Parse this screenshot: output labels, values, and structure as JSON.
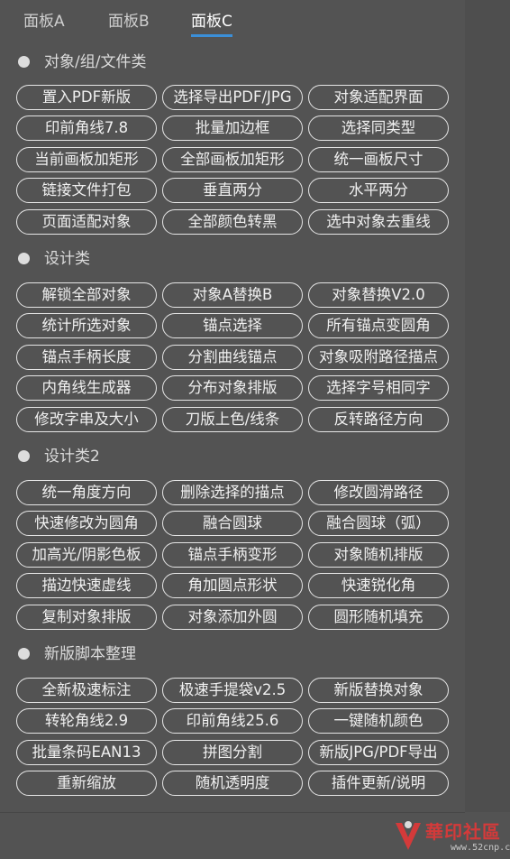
{
  "tabs": [
    {
      "label": "面板A",
      "active": false
    },
    {
      "label": "面板B",
      "active": false
    },
    {
      "label": "面板C",
      "active": true
    }
  ],
  "sections": [
    {
      "title": "对象/组/文件类",
      "buttons": [
        "置入PDF新版",
        "选择导出PDF/JPG",
        "对象适配界面",
        "印前角线7.8",
        "批量加边框",
        "选择同类型",
        "当前画板加矩形",
        "全部画板加矩形",
        "统一画板尺寸",
        "链接文件打包",
        "垂直两分",
        "水平两分",
        "页面适配对象",
        "全部颜色转黑",
        "选中对象去重线"
      ]
    },
    {
      "title": "设计类",
      "buttons": [
        "解锁全部对象",
        "对象A替换B",
        "对象替换V2.0",
        "统计所选对象",
        "锚点选择",
        "所有锚点变圆角",
        "锚点手柄长度",
        "分割曲线锚点",
        "对象吸附路径描点",
        "内角线生成器",
        "分布对象排版",
        "选择字号相同字",
        "修改字串及大小",
        "刀版上色/线条",
        "反转路径方向"
      ]
    },
    {
      "title": "设计类2",
      "buttons": [
        "统一角度方向",
        "删除选择的描点",
        "修改圆滑路径",
        "快速修改为圆角",
        "融合圆球",
        "融合圆球（弧）",
        "加高光/阴影色板",
        "锚点手柄变形",
        "对象随机排版",
        "描边快速虚线",
        "角加圆点形状",
        "快速锐化角",
        "复制对象排版",
        "对象添加外圆",
        "圆形随机填充"
      ]
    },
    {
      "title": "新版脚本整理",
      "buttons": [
        "全新极速标注",
        "极速手提袋v2.5",
        "新版替换对象",
        "转轮角线2.9",
        "印前角线25.6",
        "一键随机颜色",
        "批量条码EAN13",
        "拼图分割",
        "新版JPG/PDF导出",
        "重新缩放",
        "随机透明度",
        "插件更新/说明"
      ]
    }
  ],
  "watermark": {
    "text": "華印社區",
    "url": "www.52cnp.com"
  },
  "colors": {
    "background": "#535353",
    "button_border": "#e6e6e6",
    "tab_underline": "#3b8fd8",
    "watermark": "#d43a3a"
  }
}
